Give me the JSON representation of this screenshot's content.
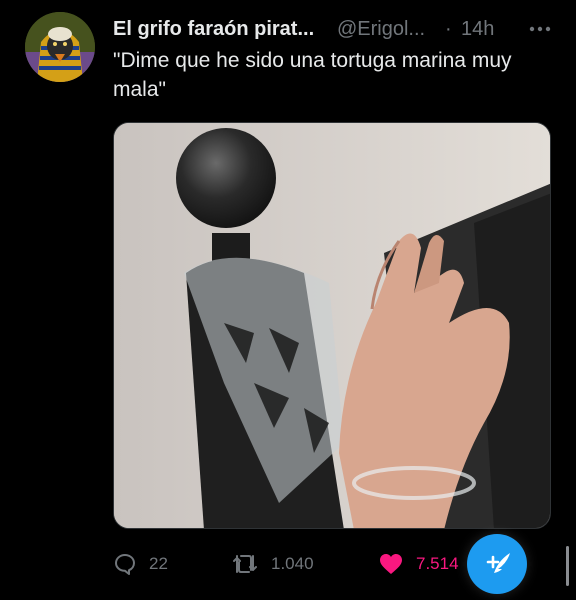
{
  "tweet": {
    "display_name": "El grifo faraón pirat...",
    "handle": "@Erigol...",
    "separator": "·",
    "time": "14h",
    "text": "\"Dime que he sido una tortuga marina muy mala\""
  },
  "stats": {
    "replies": "22",
    "retweets": "1.040",
    "likes": "7.514"
  },
  "icons": {
    "avatar": "pharaoh-avatar",
    "more": "more-dots-icon",
    "reply": "reply-icon",
    "retweet": "retweet-icon",
    "like": "heart-icon",
    "compose": "compose-tweet-icon"
  },
  "colors": {
    "background": "#000000",
    "text": "#e7e9ea",
    "muted": "#71767b",
    "like": "#f91880",
    "accent": "#1d9bf0"
  }
}
